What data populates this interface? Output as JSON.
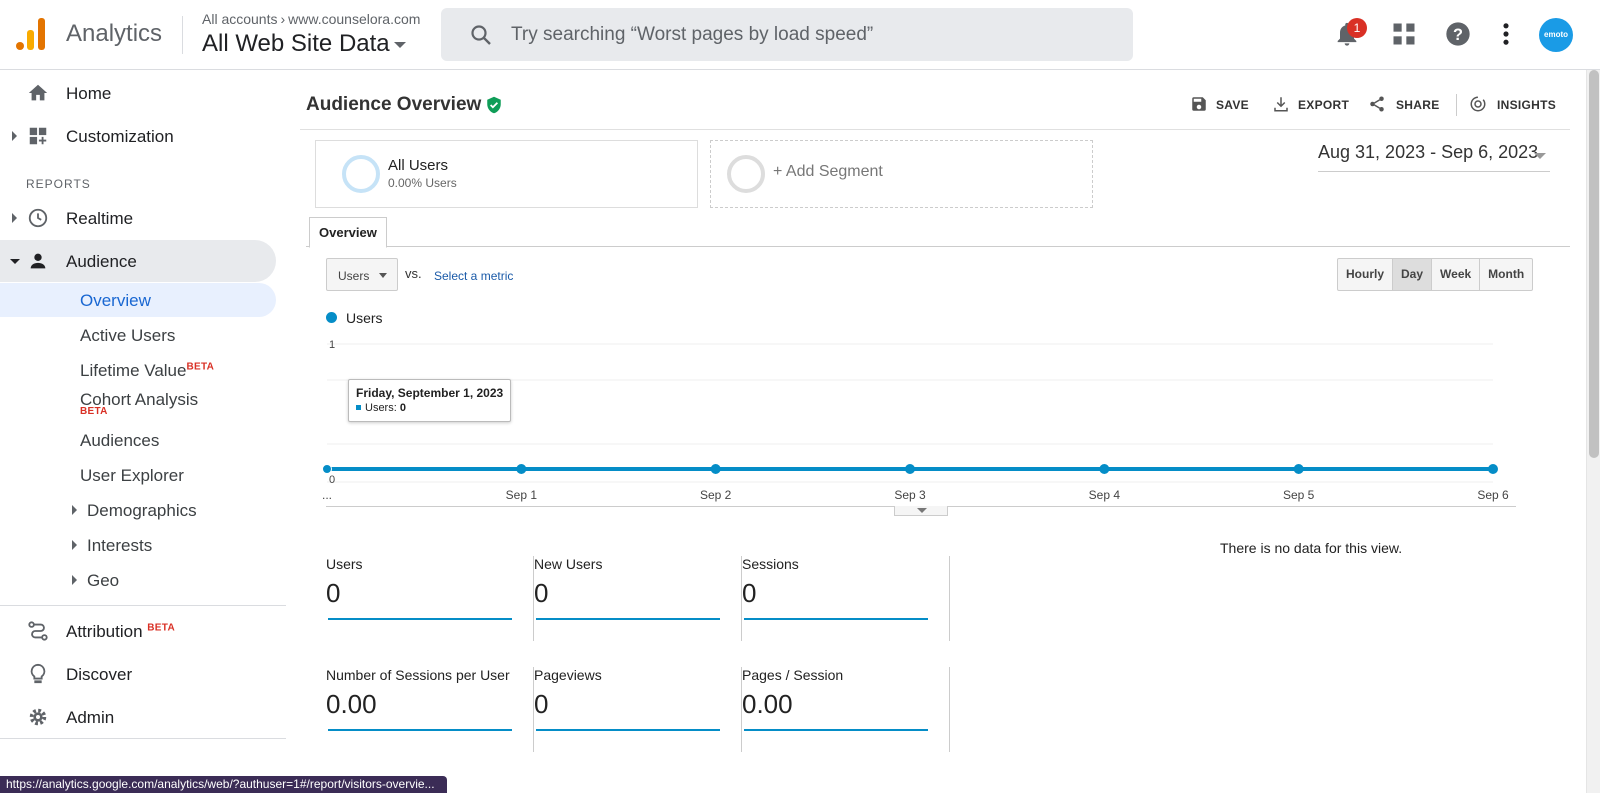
{
  "header": {
    "app_name": "Analytics",
    "breadcrumb_all": "All accounts",
    "breadcrumb_site": "www.counselora.com",
    "property": "All Web Site Data",
    "search_placeholder": "Try searching “Worst pages by load speed”",
    "notification_count": "1",
    "avatar_text": "emoto"
  },
  "sidebar": {
    "home": "Home",
    "customization": "Customization",
    "reports_label": "REPORTS",
    "realtime": "Realtime",
    "audience": "Audience",
    "audience_items": {
      "overview": "Overview",
      "active_users": "Active Users",
      "lifetime_value": "Lifetime Value",
      "cohort_analysis": "Cohort Analysis",
      "audiences": "Audiences",
      "user_explorer": "User Explorer",
      "demographics": "Demographics",
      "interests": "Interests",
      "geo": "Geo"
    },
    "beta_label": "BETA",
    "attribution": "Attribution",
    "discover": "Discover",
    "admin": "Admin"
  },
  "page": {
    "title": "Audience Overview",
    "actions": {
      "save": "SAVE",
      "export": "EXPORT",
      "share": "SHARE",
      "insights": "INSIGHTS"
    },
    "segment": {
      "name": "All Users",
      "sub": "0.00% Users",
      "add": "+ Add Segment"
    },
    "date_range": "Aug 31, 2023 - Sep 6, 2023",
    "tab": "Overview",
    "metric_select": "Users",
    "vs": "vs.",
    "select_metric": "Select a metric",
    "granularity": [
      "Hourly",
      "Day",
      "Week",
      "Month"
    ],
    "granularity_selected": "Day",
    "tooltip": {
      "title": "Friday, September 1, 2023",
      "series": "Users:",
      "value": "0"
    },
    "no_data": "There is no data for this view."
  },
  "chart_data": {
    "type": "line",
    "x": [
      "...",
      "Sep 1",
      "Sep 2",
      "Sep 3",
      "Sep 4",
      "Sep 5",
      "Sep 6"
    ],
    "series": [
      {
        "name": "Users",
        "values": [
          0,
          0,
          0,
          0,
          0,
          0,
          0
        ]
      }
    ],
    "yticks": [
      "1",
      "0"
    ],
    "ylim": [
      0,
      1
    ],
    "grid": true,
    "legend": "top-left",
    "color": "#058dc7"
  },
  "kpis": [
    {
      "label": "Users",
      "value": "0"
    },
    {
      "label": "New Users",
      "value": "0"
    },
    {
      "label": "Sessions",
      "value": "0"
    },
    {
      "label": "Number of Sessions per User",
      "value": "0.00"
    },
    {
      "label": "Pageviews",
      "value": "0"
    },
    {
      "label": "Pages / Session",
      "value": "0.00"
    }
  ],
  "status_url": "https://analytics.google.com/analytics/web/?authuser=1#/report/visitors-overvie..."
}
